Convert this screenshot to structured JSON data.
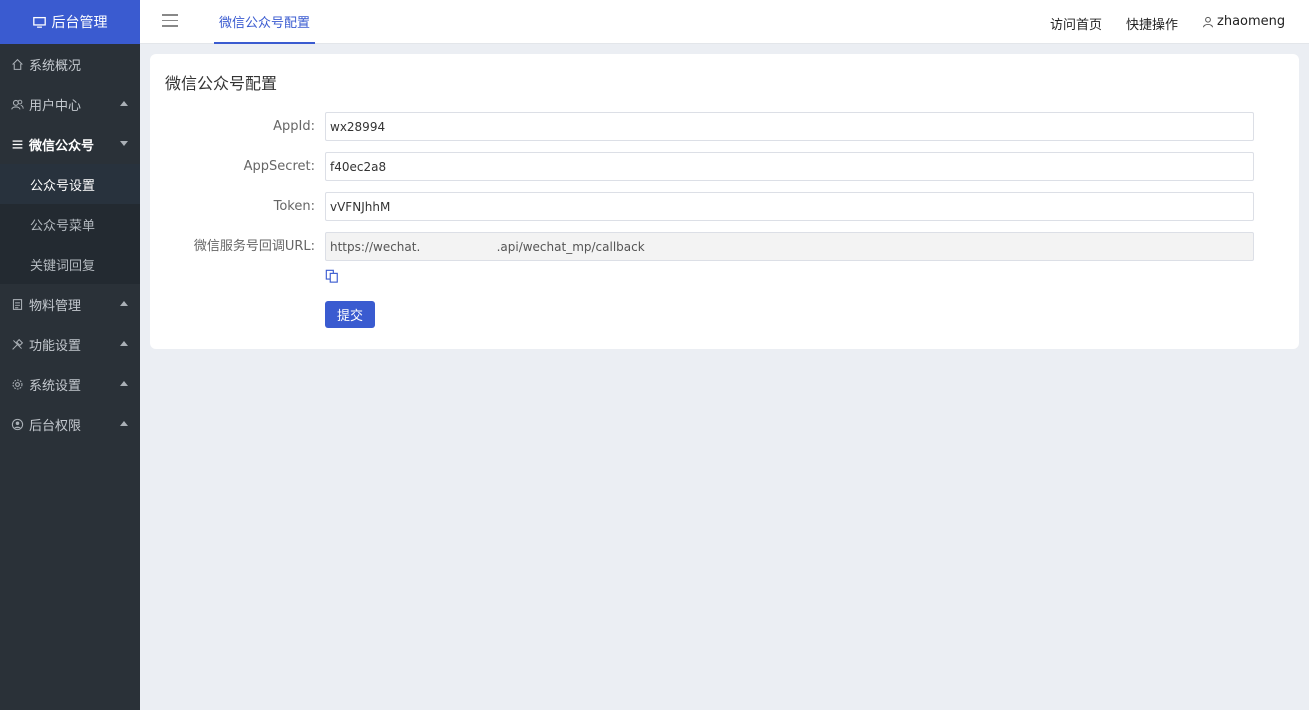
{
  "sidebar": {
    "brand": "后台管理",
    "items": [
      {
        "label": "系统概况"
      },
      {
        "label": "用户中心"
      },
      {
        "label": "微信公众号"
      },
      {
        "label": "物料管理"
      },
      {
        "label": "功能设置"
      },
      {
        "label": "系统设置"
      },
      {
        "label": "后台权限"
      }
    ],
    "subitems": [
      {
        "label": "公众号设置"
      },
      {
        "label": "公众号菜单"
      },
      {
        "label": "关键词回复"
      }
    ]
  },
  "header": {
    "tab_label": "微信公众号配置",
    "visit_home": "访问首页",
    "quick_ops": "快捷操作",
    "username": "zhaomeng"
  },
  "form": {
    "title": "微信公众号配置",
    "fields": [
      {
        "label": "AppId:",
        "value": "wx28994"
      },
      {
        "label": "AppSecret:",
        "value": "f40ec2a8"
      },
      {
        "label": "Token:",
        "value": "vVFNJhhM"
      },
      {
        "label": "微信服务号回调URL:",
        "value": "https://wechat.                    .api/wechat_mp/callback"
      }
    ],
    "submit_label": "提交"
  },
  "colors": {
    "accent": "#3a5bd0",
    "sidebar_bg": "#2a3138",
    "page_bg": "#ebeef3"
  }
}
